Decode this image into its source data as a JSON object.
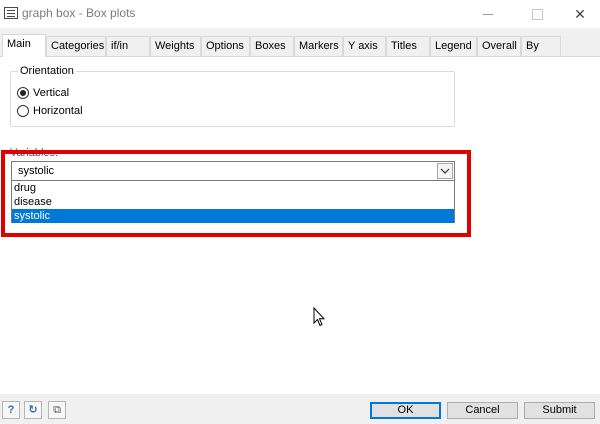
{
  "window": {
    "title": "graph box - Box plots",
    "minimize_glyph": "",
    "close_glyph": "✕"
  },
  "tabs": [
    {
      "label": "Main",
      "active": true
    },
    {
      "label": "Categories"
    },
    {
      "label": "if/in"
    },
    {
      "label": "Weights"
    },
    {
      "label": "Options"
    },
    {
      "label": "Boxes"
    },
    {
      "label": "Markers"
    },
    {
      "label": "Y axis"
    },
    {
      "label": "Titles"
    },
    {
      "label": "Legend"
    },
    {
      "label": "Overall"
    },
    {
      "label": "By"
    }
  ],
  "orientation": {
    "legend": "Orientation",
    "options": [
      {
        "label": "Vertical",
        "checked": true
      },
      {
        "label": "Horizontal",
        "checked": false
      }
    ]
  },
  "variables": {
    "label": "Variables:",
    "selected_value": "systolic",
    "options": [
      "drug",
      "disease",
      "systolic"
    ],
    "highlighted_index": 2
  },
  "footer": {
    "icons": [
      "help-icon",
      "reset-icon",
      "copy-icon"
    ],
    "help_glyph": "?",
    "reset_glyph": "↻",
    "copy_glyph": "⧉",
    "ok_label": "OK",
    "cancel_label": "Cancel",
    "submit_label": "Submit"
  },
  "colors": {
    "selection": "#0078d7",
    "annotation_outline": "#e00000"
  }
}
